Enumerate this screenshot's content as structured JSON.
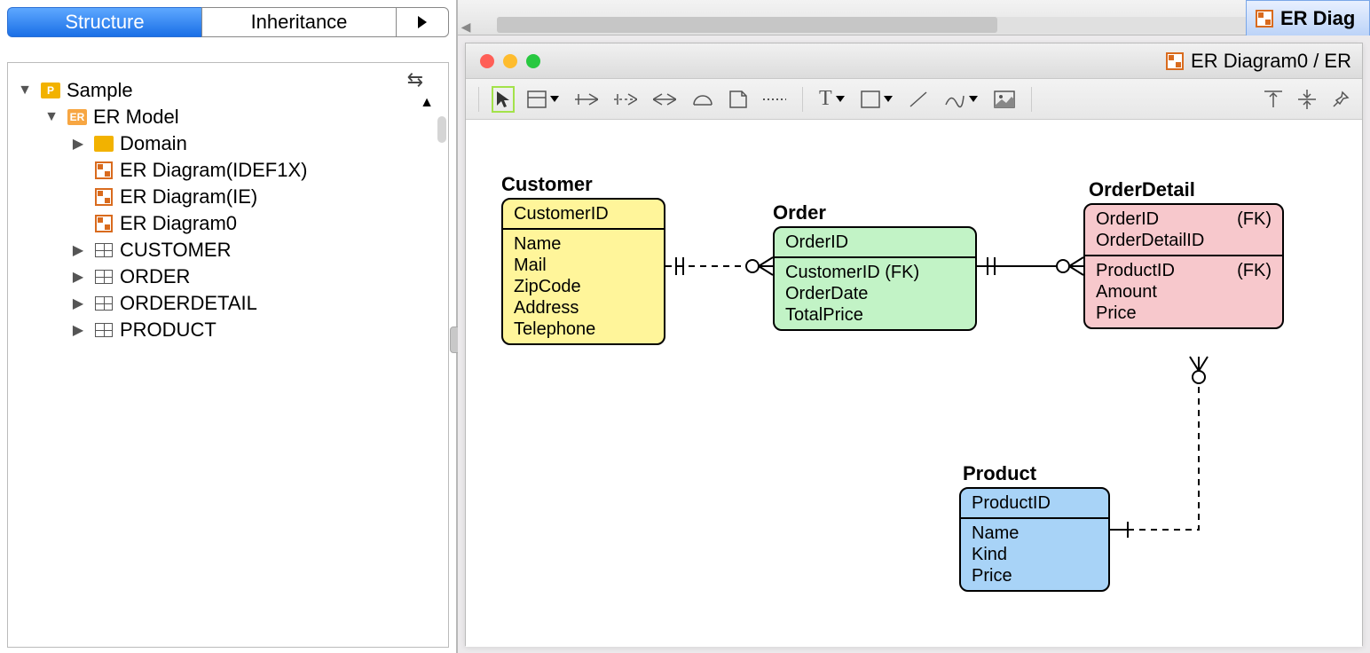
{
  "sidebar": {
    "tabs": {
      "structure": "Structure",
      "inheritance": "Inheritance"
    }
  },
  "tree": {
    "root": {
      "label": "Sample",
      "badge": "P"
    },
    "ermodel": {
      "label": "ER Model",
      "badge": "ER"
    },
    "domain": "Domain",
    "diag_idef1x": "ER Diagram(IDEF1X)",
    "diag_ie": "ER Diagram(IE)",
    "diag0": "ER Diagram0",
    "t_customer": "CUSTOMER",
    "t_order": "ORDER",
    "t_orderdetail": "ORDERDETAIL",
    "t_product": "PRODUCT"
  },
  "filetab": "ER Diag",
  "window_title": "ER Diagram0 / ER",
  "entities": {
    "customer": {
      "title": "Customer",
      "pk": "CustomerID",
      "attrs": [
        "Name",
        "Mail",
        "ZipCode",
        "Address",
        "Telephone"
      ]
    },
    "order": {
      "title": "Order",
      "pk": "OrderID",
      "attrs": [
        "CustomerID (FK)",
        "OrderDate",
        "TotalPrice"
      ]
    },
    "orderdetail": {
      "title": "OrderDetail",
      "pk1_name": "OrderID",
      "pk1_fk": "(FK)",
      "pk2": "OrderDetailID",
      "attr1_name": "ProductID",
      "attr1_fk": "(FK)",
      "attr2": "Amount",
      "attr3": "Price"
    },
    "product": {
      "title": "Product",
      "pk": "ProductID",
      "attrs": [
        "Name",
        "Kind",
        "Price"
      ]
    }
  },
  "chart_data": {
    "type": "er-diagram",
    "entities": [
      {
        "name": "Customer",
        "color": "#fff59a",
        "primary_keys": [
          "CustomerID"
        ],
        "attributes": [
          "Name",
          "Mail",
          "ZipCode",
          "Address",
          "Telephone"
        ]
      },
      {
        "name": "Order",
        "color": "#c2f3c6",
        "primary_keys": [
          "OrderID"
        ],
        "attributes": [
          "CustomerID (FK)",
          "OrderDate",
          "TotalPrice"
        ]
      },
      {
        "name": "OrderDetail",
        "color": "#f7c8cc",
        "primary_keys": [
          "OrderID (FK)",
          "OrderDetailID"
        ],
        "attributes": [
          "ProductID (FK)",
          "Amount",
          "Price"
        ]
      },
      {
        "name": "Product",
        "color": "#a8d3f7",
        "primary_keys": [
          "ProductID"
        ],
        "attributes": [
          "Name",
          "Kind",
          "Price"
        ]
      }
    ],
    "relationships": [
      {
        "from": "Customer",
        "to": "Order",
        "type": "one-to-many",
        "identifying": false
      },
      {
        "from": "Order",
        "to": "OrderDetail",
        "type": "one-to-many",
        "identifying": true
      },
      {
        "from": "Product",
        "to": "OrderDetail",
        "type": "one-to-many",
        "identifying": false
      }
    ]
  }
}
